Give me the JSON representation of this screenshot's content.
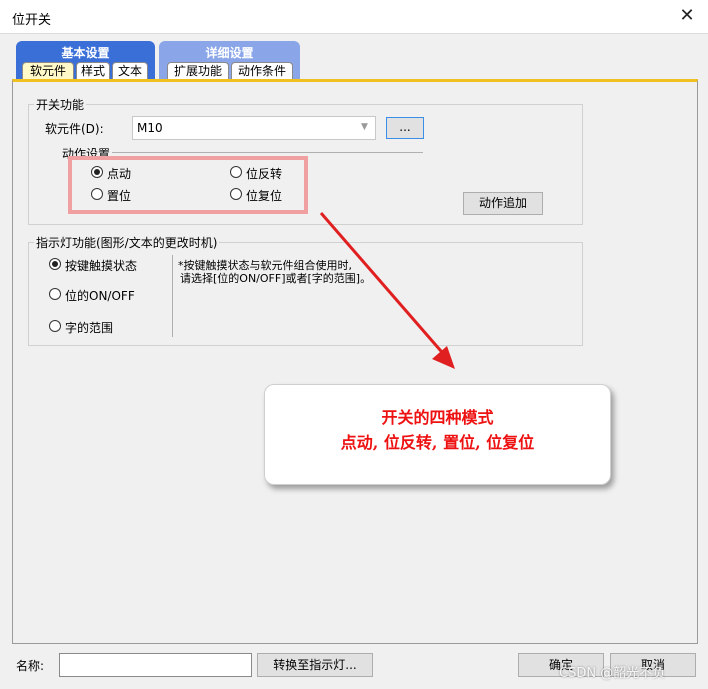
{
  "window": {
    "title": "位开关",
    "close_icon": "close-icon"
  },
  "group_tabs": [
    {
      "label": "基本设置",
      "color": "#3a6fd8"
    },
    {
      "label": "详细设置",
      "color": "#8aa6e8"
    }
  ],
  "sub_tabs": [
    "软元件",
    "样式",
    "文本",
    "扩展功能",
    "动作条件"
  ],
  "switch_func": {
    "legend": "开关功能",
    "device_label": "软元件(D):",
    "device_value": "M10",
    "browse_label": "...",
    "action_settings": {
      "legend": "动作设置",
      "options": [
        "点动",
        "位反转",
        "置位",
        "位复位"
      ],
      "selected": "点动"
    },
    "add_action_label": "动作追加"
  },
  "indicator": {
    "legend": "指示灯功能(图形/文本的更改时机)",
    "options": [
      "按键触摸状态",
      "位的ON/OFF",
      "字的范围"
    ],
    "selected": "按键触摸状态",
    "note_line1": "*按键触摸状态与软元件组合使用时,",
    "note_line2": "请选择[位的ON/OFF]或者[字的范围]。"
  },
  "callout": {
    "line1": "开关的四种模式",
    "line2": "点动, 位反转, 置位, 位复位"
  },
  "footer": {
    "name_label": "名称:",
    "name_value": "",
    "convert_label": "转换至指示灯...",
    "ok_label": "确定",
    "cancel_label": "取消"
  },
  "watermark": "CSDN @韶光不负",
  "colors": {
    "highlight_box": "#f0a0a0",
    "arrow": "#e02020",
    "callout_text": "#ee1111",
    "active_tab_fill": "#fff8c8",
    "tab_underline": "#f0c020"
  }
}
